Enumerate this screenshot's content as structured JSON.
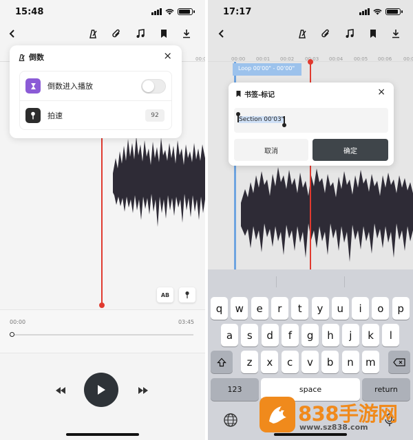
{
  "left_screen": {
    "status_time": "15:48",
    "toolbar_icons": [
      "back-icon",
      "metronome-icon",
      "paperclip-icon",
      "music-note-icon",
      "bookmark-icon",
      "download-icon"
    ],
    "ruler_tick": "00:0",
    "countdown_panel": {
      "title": "倒数",
      "close_glyph": "×",
      "rows": [
        {
          "label": "倒数进入播放",
          "icon": "hourglass-icon",
          "icon_color": "#8b5bd6",
          "toggle_on": false
        },
        {
          "label": "拍速",
          "icon": "metronome-pin-icon",
          "icon_color": "#2c2c2c",
          "value": "92"
        }
      ]
    },
    "ab_button": "AB",
    "timeline": {
      "start": "00:00",
      "end": "03:45",
      "progress": 0
    },
    "accent_color": "#e03a2f"
  },
  "right_screen": {
    "status_time": "17:17",
    "ruler_ticks": [
      "00:00",
      "00:01",
      "00:02",
      "00:03",
      "00:04",
      "00:05",
      "00:06",
      "00:0"
    ],
    "loop_label": "Loop 00'00\" - 00'00\"",
    "bookmark_dialog": {
      "title": "书签-标记",
      "close_glyph": "×",
      "input_value": "Section 00'03\"",
      "cancel": "取消",
      "confirm": "确定"
    },
    "keyboard": {
      "row1": [
        "q",
        "w",
        "e",
        "r",
        "t",
        "y",
        "u",
        "i",
        "o",
        "p"
      ],
      "row2": [
        "a",
        "s",
        "d",
        "f",
        "g",
        "h",
        "j",
        "k",
        "l"
      ],
      "row3": [
        "z",
        "x",
        "c",
        "v",
        "b",
        "n",
        "m"
      ],
      "numbers_key": "123",
      "space_key": "space",
      "return_key": "return"
    },
    "watermark": {
      "brand": "838手游网",
      "url": "www.sz838.com"
    }
  }
}
